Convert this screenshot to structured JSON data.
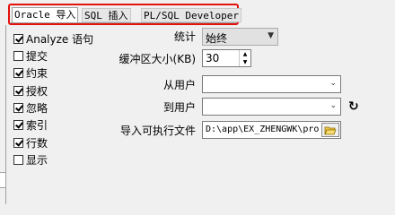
{
  "tabs": [
    {
      "label": "Oracle 导入"
    },
    {
      "label": "SQL 插入"
    },
    {
      "label": "PL/SQL Developer"
    }
  ],
  "options": [
    {
      "label": "Analyze 语句",
      "checked": true
    },
    {
      "label": "提交",
      "checked": false
    },
    {
      "label": "约束",
      "checked": true
    },
    {
      "label": "授权",
      "checked": true
    },
    {
      "label": "忽略",
      "checked": true
    },
    {
      "label": "索引",
      "checked": true
    },
    {
      "label": "行数",
      "checked": true
    },
    {
      "label": "显示",
      "checked": false
    }
  ],
  "statistics": {
    "label": "统计",
    "value": "始终"
  },
  "buffer": {
    "label": "缓冲区大小(KB)",
    "value": "30"
  },
  "from_user": {
    "label": "从用户",
    "value": ""
  },
  "to_user": {
    "label": "到用户",
    "value": ""
  },
  "executable": {
    "label": "导入可执行文件",
    "value": "D:\\app\\EX_ZHENGWK\\pro"
  },
  "colors": {
    "highlight": "#e3120b"
  }
}
